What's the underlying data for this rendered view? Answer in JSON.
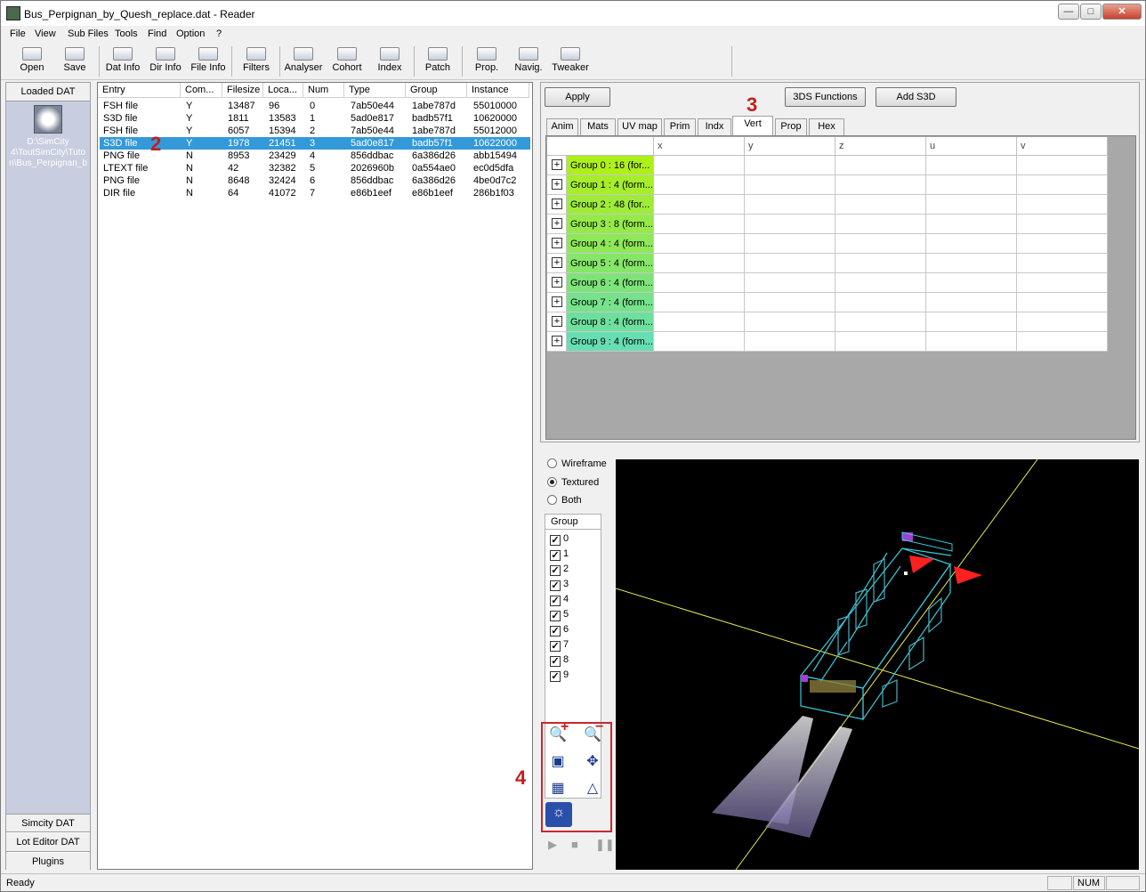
{
  "window": {
    "title": "Bus_Perpignan_by_Quesh_replace.dat - Reader"
  },
  "menu": [
    "File",
    "View",
    "Sub Files",
    "Tools",
    "Find",
    "Option",
    "?"
  ],
  "toolbar": [
    "Open",
    "Save",
    "Dat Info",
    "Dir Info",
    "File Info",
    "Filters",
    "Analyser",
    "Cohort",
    "Index",
    "Patch",
    "Prop.",
    "Navig.",
    "Tweaker"
  ],
  "leftnav": {
    "loaded": "Loaded DAT",
    "path_lines": [
      "D:\\SimCity",
      "4\\ToutSimCity\\Tuto",
      "n\\Bus_Perpignan_b"
    ],
    "simcity": "Simcity DAT",
    "loteditor": "Lot Editor DAT",
    "plugins": "Plugins"
  },
  "filelist": {
    "columns": [
      "Entry",
      "Com...",
      "Filesize",
      "Loca...",
      "Num",
      "Type",
      "Group",
      "Instance"
    ],
    "rows": [
      [
        "FSH file",
        "Y",
        "13487",
        "96",
        "0",
        "7ab50e44",
        "1abe787d",
        "55010000"
      ],
      [
        "S3D file",
        "Y",
        "1811",
        "13583",
        "1",
        "5ad0e817",
        "badb57f1",
        "10620000"
      ],
      [
        "FSH file",
        "Y",
        "6057",
        "15394",
        "2",
        "7ab50e44",
        "1abe787d",
        "55012000"
      ],
      [
        "S3D file",
        "Y",
        "1978",
        "21451",
        "3",
        "5ad0e817",
        "badb57f1",
        "10622000"
      ],
      [
        "PNG file",
        "N",
        "8953",
        "23429",
        "4",
        "856ddbac",
        "6a386d26",
        "abb15494"
      ],
      [
        "LTEXT file",
        "N",
        "42",
        "32382",
        "5",
        "2026960b",
        "0a554ae0",
        "ec0d5dfa"
      ],
      [
        "PNG file",
        "N",
        "8648",
        "32424",
        "6",
        "856ddbac",
        "6a386d26",
        "4be0d7c2"
      ],
      [
        "DIR file",
        "N",
        "64",
        "41072",
        "7",
        "e86b1eef",
        "e86b1eef",
        "286b1f03"
      ]
    ],
    "selected_row": 3
  },
  "editor": {
    "apply": "Apply",
    "functions": "3DS Functions",
    "add": "Add S3D",
    "tabs": [
      "Anim",
      "Mats",
      "UV map",
      "Prim",
      "Indx",
      "Vert",
      "Prop",
      "Hex"
    ],
    "active_tab": "Vert",
    "grid_columns": [
      "x",
      "y",
      "z",
      "u",
      "v"
    ],
    "groups": [
      "Group 0 : 16 (for...",
      "Group 1 : 4 (form...",
      "Group 2 : 48 (for...",
      "Group 3 : 8 (form...",
      "Group 4 : 4 (form...",
      "Group 5 : 4 (form...",
      "Group 6 : 4 (form...",
      "Group 7 : 4 (form...",
      "Group 8 : 4 (form...",
      "Group 9 : 4 (form..."
    ],
    "group_colors": [
      "#aef01a",
      "#a6ee2a",
      "#9eec38",
      "#96ea48",
      "#8ee858",
      "#86e668",
      "#7ee47a",
      "#76e28c",
      "#6ee09e",
      "#66deb2"
    ]
  },
  "viewer": {
    "modes": [
      "Wireframe",
      "Textured",
      "Both"
    ],
    "selected_mode": "Textured",
    "group_header": "Group",
    "group_items": [
      "0",
      "1",
      "2",
      "3",
      "4",
      "5",
      "6",
      "7",
      "8",
      "9"
    ],
    "tools": [
      "zoom-in-icon",
      "zoom-out-icon",
      "fit-view-icon",
      "center-icon",
      "grid-icon",
      "perspective-icon",
      "lighting-icon"
    ],
    "playback": [
      "play-icon",
      "stop-icon",
      "pause-icon"
    ]
  },
  "annotations": [
    "2",
    "3",
    "4"
  ],
  "status": {
    "text": "Ready",
    "num": "NUM"
  }
}
